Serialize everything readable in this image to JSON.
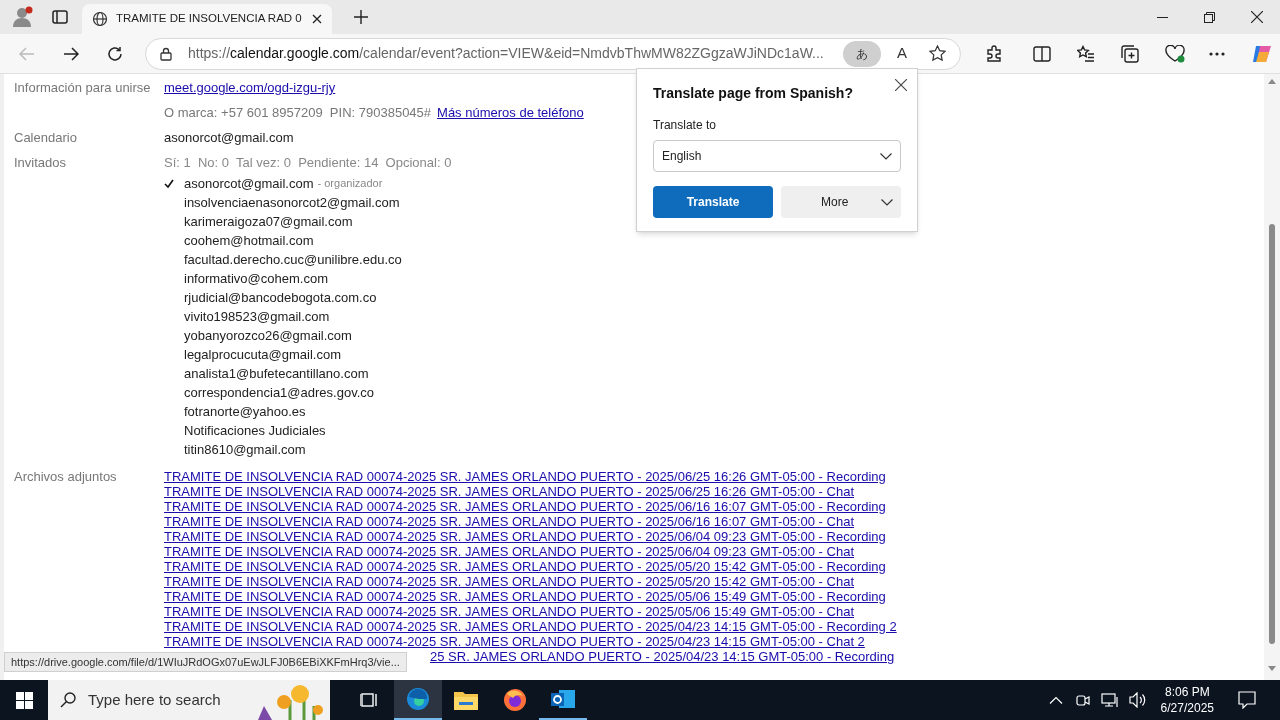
{
  "browser": {
    "tab": {
      "title": "TRAMITE DE INSOLVENCIA RAD 0",
      "selected": true
    },
    "url": {
      "scheme": "https://",
      "host": "calendar.google.com",
      "path": "/calendar/event?action=VIEW&eid=NmdvbThwMW82ZGgzaWJiNDc1aW..."
    },
    "translate_badge": "あ",
    "read_aloud": "A"
  },
  "event": {
    "join": {
      "label": "Información para unirse",
      "link": "meet.google.com/ogd-izgu-rjy",
      "phone": "O marca: +57 601 8957209  PIN: 790385045#",
      "more_link": "Más números de teléfono"
    },
    "calendar": {
      "label": "Calendario",
      "value": "asonorcot@gmail.com"
    },
    "guests": {
      "label": "Invitados",
      "summary": "Sí: 1  No: 0  Tal vez: 0  Pendiente: 14  Opcional: 0",
      "list": [
        {
          "email": "asonorcot@gmail.com",
          "accepted": true,
          "note": "- organizador"
        },
        {
          "email": "insolvenciaenasonorcot2@gmail.com",
          "accepted": false
        },
        {
          "email": "karimeraigoza07@gmail.com",
          "accepted": false
        },
        {
          "email": "coohem@hotmail.com",
          "accepted": false
        },
        {
          "email": "facultad.derecho.cuc@unilibre.edu.co",
          "accepted": false
        },
        {
          "email": "informativo@cohem.com",
          "accepted": false
        },
        {
          "email": "rjudicial@bancodebogota.com.co",
          "accepted": false
        },
        {
          "email": "vivito198523@gmail.com",
          "accepted": false
        },
        {
          "email": "yobanyorozco26@gmail.com",
          "accepted": false
        },
        {
          "email": "legalprocucuta@gmail.com",
          "accepted": false
        },
        {
          "email": "analista1@bufetecantillano.com",
          "accepted": false
        },
        {
          "email": "correspondencia1@adres.gov.co",
          "accepted": false
        },
        {
          "email": "fotranorte@yahoo.es",
          "accepted": false
        },
        {
          "email": "Notificaciones Judiciales",
          "accepted": false
        },
        {
          "email": "titin8610@gmail.com",
          "accepted": false
        }
      ]
    },
    "attachments": {
      "label": "Archivos adjuntos",
      "list": [
        "TRAMITE DE INSOLVENCIA RAD 00074-2025 SR. JAMES ORLANDO PUERTO - 2025/06/25 16:26 GMT-05:00 - Recording",
        "TRAMITE DE INSOLVENCIA RAD 00074-2025 SR. JAMES ORLANDO PUERTO - 2025/06/25 16:26 GMT-05:00 - Chat",
        "TRAMITE DE INSOLVENCIA RAD 00074-2025 SR. JAMES ORLANDO PUERTO - 2025/06/16 16:07 GMT-05:00 - Recording",
        "TRAMITE DE INSOLVENCIA RAD 00074-2025 SR. JAMES ORLANDO PUERTO - 2025/06/16 16:07 GMT-05:00 - Chat",
        "TRAMITE DE INSOLVENCIA RAD 00074-2025 SR. JAMES ORLANDO PUERTO - 2025/06/04 09:23 GMT-05:00 - Recording",
        "TRAMITE DE INSOLVENCIA RAD 00074-2025 SR. JAMES ORLANDO PUERTO - 2025/06/04 09:23 GMT-05:00 - Chat",
        "TRAMITE DE INSOLVENCIA RAD 00074-2025 SR. JAMES ORLANDO PUERTO - 2025/05/20 15:42 GMT-05:00 - Recording",
        "TRAMITE DE INSOLVENCIA RAD 00074-2025 SR. JAMES ORLANDO PUERTO - 2025/05/20 15:42 GMT-05:00 - Chat",
        "TRAMITE DE INSOLVENCIA RAD 00074-2025 SR. JAMES ORLANDO PUERTO - 2025/05/06 15:49 GMT-05:00 - Recording",
        "TRAMITE DE INSOLVENCIA RAD 00074-2025 SR. JAMES ORLANDO PUERTO - 2025/05/06 15:49 GMT-05:00 - Chat",
        "TRAMITE DE INSOLVENCIA RAD 00074-2025 SR. JAMES ORLANDO PUERTO - 2025/04/23 14:15 GMT-05:00 - Recording 2",
        "TRAMITE DE INSOLVENCIA RAD 00074-2025 SR. JAMES ORLANDO PUERTO - 2025/04/23 14:15 GMT-05:00 - Chat 2"
      ],
      "covered_tail": "25 SR. JAMES ORLANDO PUERTO - 2025/04/23 14:15 GMT-05:00 - Recording"
    }
  },
  "translate_popup": {
    "title": "Translate page from Spanish?",
    "label": "Translate to",
    "language": "English",
    "translate_button": "Translate",
    "more_button": "More"
  },
  "status_url": "https://drive.google.com/file/d/1WIuJRdOGx07uEwJLFJ0B6EBiXKFmHrq3/vie...",
  "taskbar": {
    "search_placeholder": "Type here to search",
    "time": "8:06 PM",
    "date": "6/27/2025"
  }
}
